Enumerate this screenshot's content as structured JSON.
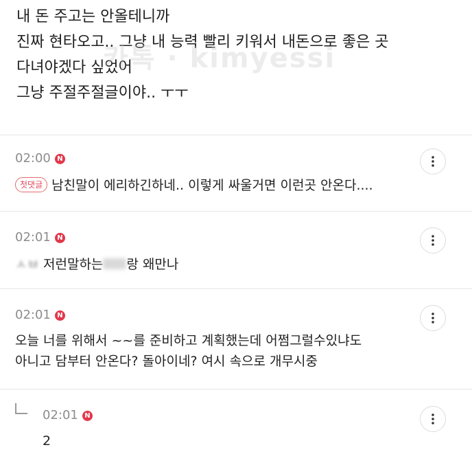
{
  "post": {
    "lines": [
      "내 돈 주고는 안올테니까",
      "진짜 현타오고.. 그냥 내 능력 빨리 키워서 내돈으로 좋은 곳",
      "다녀야겠다 싶었어",
      "그냥 주절주절글이야.. ㅜㅜ"
    ],
    "watermark": "카톡 · kimyessi"
  },
  "comments": [
    {
      "time": "02:00",
      "badge": "N",
      "first_badge": "첫댓글",
      "text": "남친말이 에리하긴하네.. 이렇게 싸울거면 이런곳 안온다...."
    },
    {
      "time": "02:01",
      "badge": "N",
      "text_before": "ㅅㅂ",
      "text_middle": " 저런말하는",
      "text_after": "랑 왜만나"
    },
    {
      "time": "02:01",
      "badge": "N",
      "lines": [
        "오늘 너를 위해서 ~~를 준비하고 계획했는데 어쩜그럴수있냐도",
        "아니고 담부터 안온다? 돌아이네? 여시 속으로 개무시중"
      ]
    },
    {
      "time": "02:01",
      "badge": "N",
      "text": "2",
      "is_reply": true
    }
  ],
  "icons": {
    "more": "more-vertical-icon",
    "new": "new-badge-icon",
    "reply": "reply-arrow-icon"
  },
  "colors": {
    "badge_red": "#e2384c",
    "time_gray": "#8c8c8c",
    "divider": "#e6e6e6"
  }
}
